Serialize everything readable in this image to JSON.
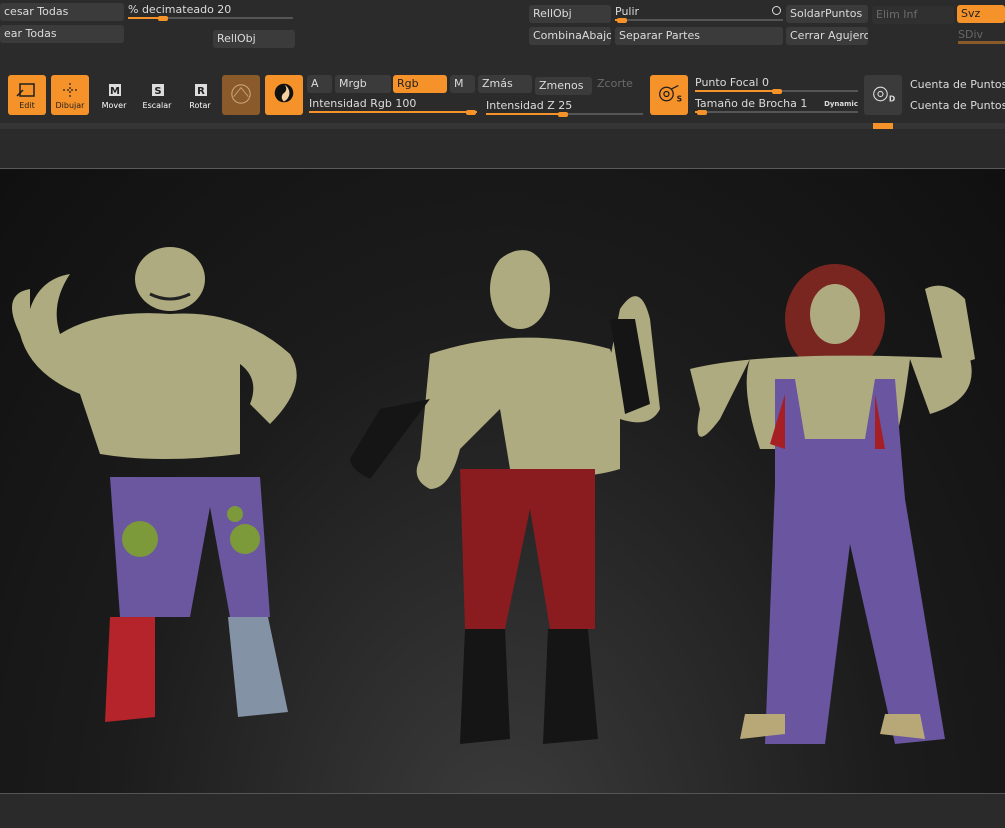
{
  "row1": {
    "procesar_todas": "cesar Todas",
    "decimate_label": "% decimateado",
    "decimate_value": "20",
    "rellobj_a": "RellObj",
    "pulir": "Pulir",
    "soldar": "SoldarPuntos",
    "elim_inf": "Elim Inf",
    "svz": "Svz"
  },
  "row2": {
    "crear_todas": "ear Todas",
    "rellobj_b": "RellObj",
    "combina": "CombinaAbajo",
    "separar": "Separar Partes",
    "cerrar": "Cerrar Agujeros",
    "sdiv": "SDiv"
  },
  "toolbar": {
    "edit": "Edit",
    "dibujar": "Dibujar",
    "mover": "Mover",
    "escalar": "Escalar",
    "rotar": "Rotar",
    "a": "A",
    "mrgb": "Mrgb",
    "rgb": "Rgb",
    "m": "M",
    "zmas": "Zmás",
    "zmenos": "Zmenos",
    "zcorte": "Zcorte",
    "intensidad_rgb_label": "Intensidad Rgb",
    "intensidad_rgb_value": "100",
    "intensidad_z_label": "Intensidad Z",
    "intensidad_z_value": "25",
    "punto_focal_label": "Punto Focal",
    "punto_focal_value": "0",
    "tamano_label": "Tamaño de Brocha",
    "tamano_value": "1",
    "dynamic": "Dynamic",
    "cuenta_a": "Cuenta de Puntos A",
    "cuenta_t": "Cuenta de Puntos T"
  },
  "colors": {
    "accent": "#f6922a",
    "panel": "#2b2b2b",
    "button": "#3b3b3b",
    "skin": "#b0ad82",
    "purple": "#6a55a0",
    "red": "#a51f24"
  },
  "icons": {
    "edit": "edit-icon",
    "draw": "draw-icon",
    "move": "move-icon",
    "scale": "scale-icon",
    "rotate": "rotate-icon",
    "material": "material-sphere-icon",
    "texture": "texture-icon",
    "stroke": "stroke-icon",
    "symmetry": "symmetry-icon"
  }
}
